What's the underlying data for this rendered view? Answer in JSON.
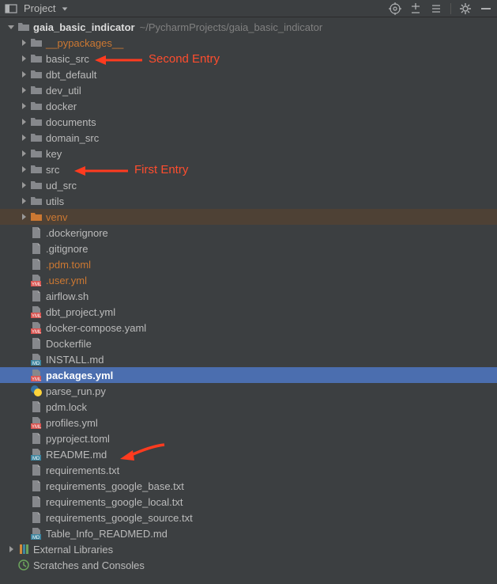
{
  "toolbar": {
    "title": "Project"
  },
  "root": {
    "project_name": "gaia_basic_indicator",
    "project_path": "~/PycharmProjects/gaia_basic_indicator"
  },
  "folders": {
    "pypackages": "__pypackages__",
    "basic_src": "basic_src",
    "dbt_default": "dbt_default",
    "dev_util": "dev_util",
    "docker": "docker",
    "documents": "documents",
    "domain_src": "domain_src",
    "key": "key",
    "src": "src",
    "ud_src": "ud_src",
    "utils": "utils",
    "venv": "venv"
  },
  "files": {
    "dockerignore": ".dockerignore",
    "gitignore": ".gitignore",
    "pdm_toml": ".pdm.toml",
    "user_yml": ".user.yml",
    "airflow_sh": "airflow.sh",
    "dbt_project_yml": "dbt_project.yml",
    "docker_compose": "docker-compose.yaml",
    "dockerfile": "Dockerfile",
    "install_md": "INSTALL.md",
    "packages_yml": "packages.yml",
    "parse_run_py": "parse_run.py",
    "pdm_lock": "pdm.lock",
    "profiles_yml": "profiles.yml",
    "pyproject_toml": "pyproject.toml",
    "readme_md": "README.md",
    "requirements_txt": "requirements.txt",
    "requirements_google_base": "requirements_google_base.txt",
    "requirements_google_local": "requirements_google_local.txt",
    "requirements_google_source": "requirements_google_source.txt",
    "table_info_md": "Table_Info_READMED.md"
  },
  "bottom": {
    "external_libraries": "External Libraries",
    "scratches": "Scratches and Consoles"
  },
  "annotations": {
    "second_entry": "Second Entry",
    "first_entry": "First Entry"
  }
}
